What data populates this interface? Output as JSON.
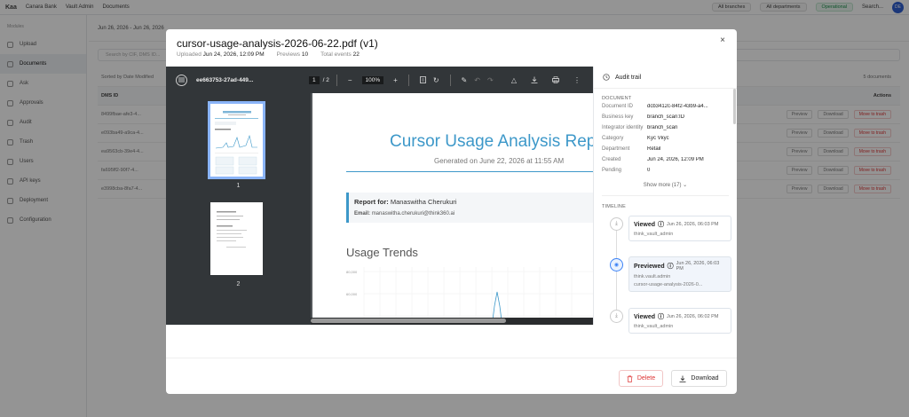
{
  "bg": {
    "logo": "Kaa",
    "crumbs": [
      "Canara Bank",
      "Vault Admin",
      "Documents"
    ],
    "branches": "All branches",
    "departments": "All departments",
    "status": "Operational",
    "search": "Search...",
    "user_initials": "DE",
    "sidebar_section": "Modules",
    "sidebar": [
      "Upload",
      "Documents",
      "Ask",
      "Approvals",
      "Audit",
      "Trash",
      "Users",
      "API keys",
      "Deployment",
      "Configuration"
    ],
    "date_filter": "Jun 26, 2026 - Jun 26, 2026",
    "search_placeholder": "Search by CIF, DMS ID...",
    "sorted": "Sorted by Date Modified",
    "count": "5 documents",
    "col_dms": "DMS ID",
    "col_actions": "Actions",
    "rows": [
      "8499fbae-afe3-4...",
      "e093ba49-a9ca-4...",
      "ea9563cb-39e4-4...",
      "fa695ff2-90f7-4...",
      "e3998cba-8fa7-4..."
    ],
    "row_actions": {
      "preview": "Preview",
      "download": "Download",
      "trash": "Move to trash"
    }
  },
  "modal": {
    "title": "cursor-usage-analysis-2026-06-22.pdf (v1)",
    "uploaded_label": "Uploaded",
    "uploaded_value": "Jun 24, 2026, 12:09 PM",
    "previews_label": "Previews",
    "previews_value": "10",
    "events_label": "Total events",
    "events_value": "22",
    "close": "×"
  },
  "viewer": {
    "filename": "ee663753-27ad-449...",
    "page_current": "1",
    "page_total": "/ 2",
    "zoom": "100%",
    "thumb_labels": [
      "1",
      "2"
    ]
  },
  "pdf": {
    "title": "Cursor Usage Analysis Rep",
    "subtitle": "Generated on June 22, 2026 at 11:55 AM",
    "report_for_label": "Report for:",
    "report_for_value": "Manaswitha Cherukuri",
    "email_label": "Email:",
    "email_value": "manaswitha.cherukuri@think360.ai",
    "section": "Usage Trends",
    "chart_ticks": [
      "80,000",
      "60,000"
    ]
  },
  "audit": {
    "title": "Audit trail",
    "doc_section": "DOCUMENT",
    "fields": [
      {
        "k": "Document ID",
        "v": "dcb3412c-84f2-43b9-a4..."
      },
      {
        "k": "Business key",
        "v": "branch_scan:ID"
      },
      {
        "k": "Integrator identity",
        "v": "branch_scan"
      },
      {
        "k": "Category",
        "v": "Kyc Vkyc"
      },
      {
        "k": "Department",
        "v": "Retail"
      },
      {
        "k": "Created",
        "v": "Jun 24, 2026, 12:09 PM"
      },
      {
        "k": "Pending",
        "v": "0"
      }
    ],
    "show_more": "Show more (17)",
    "timeline_section": "TIMELINE",
    "events": [
      {
        "action": "Viewed",
        "time": "Jun 26, 2026, 06:03 PM",
        "user": "think_vault_admin",
        "extra": ""
      },
      {
        "action": "Previewed",
        "time": "Jun 26, 2026, 06:03 PM",
        "user": "think.vault.admin",
        "extra": "cursor-usage-analysis-2026-0..."
      },
      {
        "action": "Viewed",
        "time": "Jun 26, 2026, 06:02 PM",
        "user": "think_vault_admin",
        "extra": ""
      }
    ]
  },
  "footer": {
    "delete": "Delete",
    "download": "Download"
  },
  "colors": {
    "accent": "#3d98c9",
    "danger": "#d33333",
    "timeline_highlight": "#3b82f6"
  }
}
